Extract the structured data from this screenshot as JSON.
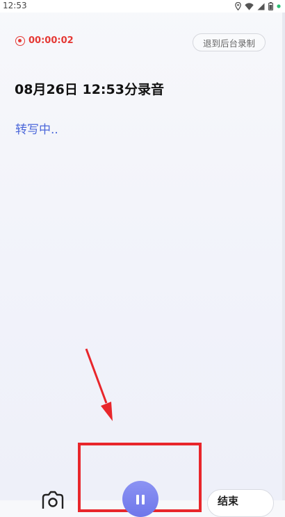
{
  "status_bar": {
    "time": "12:53",
    "icons": [
      "location-icon",
      "wifi-icon",
      "signal-icon",
      "battery-icon",
      "notification-dot-icon"
    ]
  },
  "recorder": {
    "timer": "00:00:02",
    "background_record_label": "退到后台录制",
    "title": "08月26日 12:53分录音",
    "transcribe_status": "转写中.."
  },
  "controls": {
    "camera_icon": "camera-icon",
    "pause_icon": "pause-icon",
    "end_label": "结束"
  },
  "colors": {
    "accent_red": "#e53935",
    "link_blue": "#4a66d9",
    "pause_purple": "#7a82ee",
    "annotation_red": "#e8262b"
  }
}
